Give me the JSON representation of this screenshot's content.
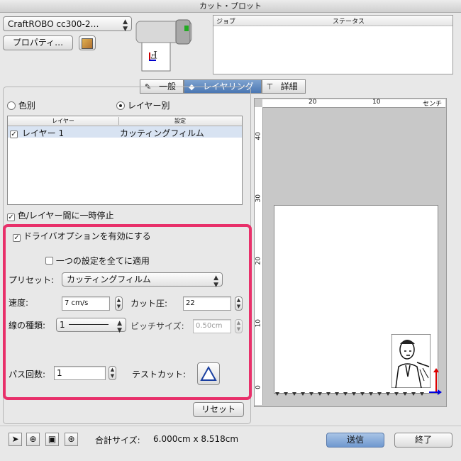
{
  "window": {
    "title": "カット・プロット"
  },
  "device": {
    "selected": "CraftROBO cc300-2…",
    "properties_label": "プロパティ…"
  },
  "job_table": {
    "col_job": "ジョブ",
    "col_status": "ステータス"
  },
  "tabs": [
    {
      "label": "一般",
      "icon": "tool-icon",
      "selected": false
    },
    {
      "label": "レイヤリング",
      "icon": "layers-icon",
      "selected": true
    },
    {
      "label": "詳細",
      "icon": "detail-icon",
      "selected": false
    }
  ],
  "layer_mode": {
    "by_color": "色別",
    "by_layer": "レイヤー別",
    "selected": "レイヤー別"
  },
  "layer_table": {
    "col_layer": "レイヤー",
    "col_setting": "設定",
    "rows": [
      {
        "layer": "レイヤー 1",
        "setting": "カッティングフィルム",
        "checked": true
      }
    ]
  },
  "pause_between": {
    "label": "色/レイヤー間に一時停止",
    "checked": true
  },
  "driver_options": {
    "enable_label": "ドライバオプションを有効にする",
    "enable_checked": true,
    "apply_all_label": "一つの設定を全てに適用",
    "apply_all_checked": false,
    "preset_label": "プリセット:",
    "preset_value": "カッティングフィルム",
    "speed_label": "速度:",
    "speed_value": "7 cm/s",
    "pressure_label": "カット圧:",
    "pressure_value": "22",
    "line_type_label": "線の種類:",
    "line_type_value": "1",
    "pitch_label": "ピッチサイズ:",
    "pitch_value": "0.50cm",
    "passes_label": "パス回数:",
    "passes_value": "1",
    "test_cut_label": "テストカット:"
  },
  "highlight_color": "#e8306a",
  "reset_label": "リセット",
  "ruler": {
    "top_labels": [
      "20",
      "10",
      "センチ"
    ],
    "left_labels": [
      "40",
      "30",
      "20",
      "10",
      "0"
    ]
  },
  "footer": {
    "total_size_label": "合計サイズ:",
    "total_size_value": "6.000cm x 8.518cm",
    "send_label": "送信",
    "finish_label": "終了"
  }
}
